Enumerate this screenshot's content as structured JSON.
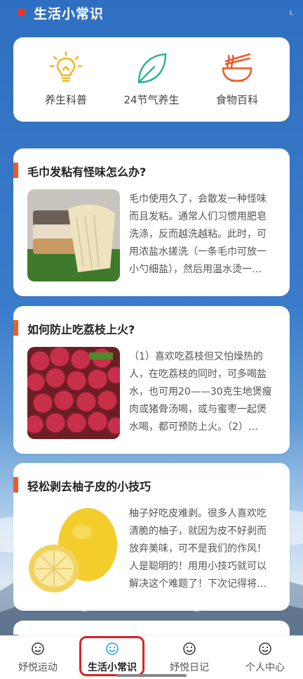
{
  "header": {
    "title": "生活小常识",
    "corner_mark": "L"
  },
  "categories": [
    {
      "label": "养生科普",
      "icon": "lightbulb-icon",
      "color": "#f2b61b"
    },
    {
      "label": "24节气养生",
      "icon": "leaf-icon",
      "color": "#2bb39a"
    },
    {
      "label": "食物百科",
      "icon": "noodle-bowl-icon",
      "color": "#f05a28"
    }
  ],
  "articles": [
    {
      "title": "毛巾发粘有怪味怎么办?",
      "image": "towel-stack-image",
      "summary": "毛巾使用久了，会散发一种怪味而且发粘。通常人们习惯用肥皂洗涤，反而越洗越粘。此时，可用浓盐水搓洗（一条毛巾可放一小勺细盐），然后用温水烫一…"
    },
    {
      "title": "如何防止吃荔枝上火?",
      "image": "lychee-image",
      "summary": "（1）喜欢吃荔枝但又怕燥热的人，在吃荔枝的同时，可多喝盐水，也可用20——30克生地煲瘦肉或猪骨汤喝，或与蜜枣一起煲水喝，都可预防上火。（2）…"
    },
    {
      "title": "轻松剥去柚子皮的小技巧",
      "image": "pomelo-image",
      "summary": "柚子好吃皮难剥。很多人喜欢吃清脆的柚子，就因为皮不好剥而放弃美味，可不是我们的作风！人是聪明的！用用小技巧就可以解决这个难题了！下次记得将…"
    }
  ],
  "tabbar": {
    "tabs": [
      {
        "label": "妤悦运动",
        "icon": "smiley-icon"
      },
      {
        "label": "生活小常识",
        "icon": "smiley-icon"
      },
      {
        "label": "妤悦日记",
        "icon": "smiley-icon"
      },
      {
        "label": "个人中心",
        "icon": "smiley-icon"
      }
    ],
    "active_index": 1,
    "accent_color": "#1aa0e8",
    "highlight_color": "#d9232a"
  }
}
